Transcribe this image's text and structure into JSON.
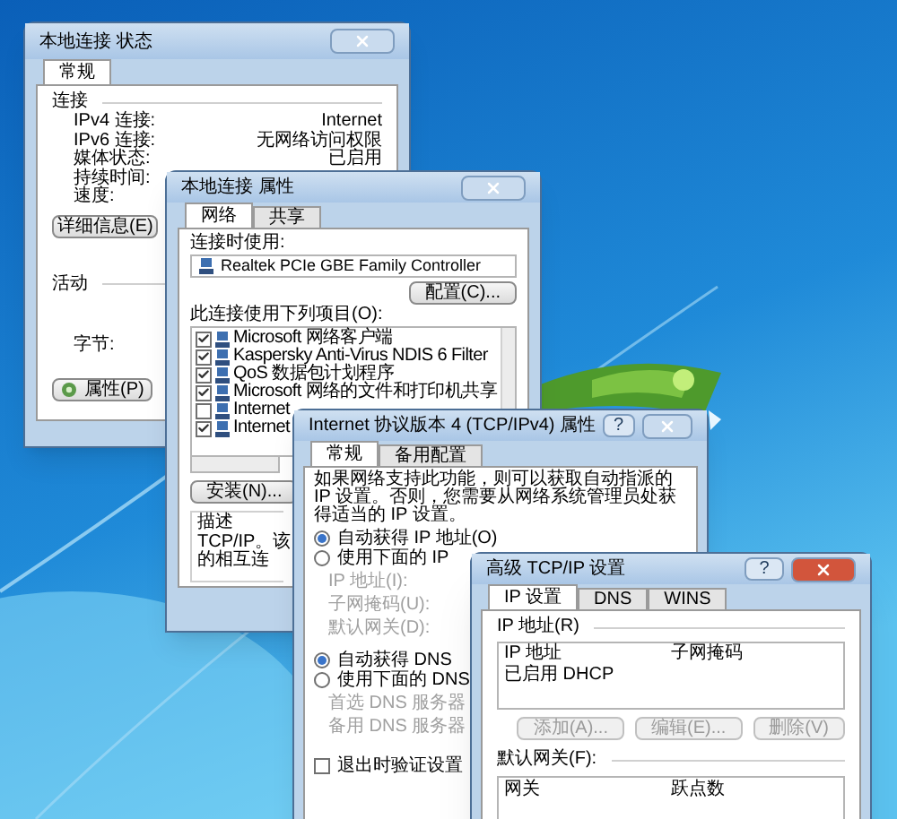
{
  "status_window": {
    "title": "本地连接 状态",
    "active": false,
    "tabs": [
      {
        "label": "常规",
        "selected": true
      }
    ],
    "connection_heading": "连接",
    "rows": [
      {
        "label": "IPv4 连接:",
        "value": "Internet"
      },
      {
        "label": "IPv6 连接:",
        "value": "无网络访问权限"
      },
      {
        "label": "媒体状态:",
        "value": "已启用"
      },
      {
        "label": "持续时间:"
      },
      {
        "label": "速度:"
      }
    ],
    "details_button": "详细信息(E)",
    "activity_heading": "活动",
    "bytes_label": "字节:",
    "properties_button": "属性(P)"
  },
  "properties_window": {
    "title": "本地连接 属性",
    "active": false,
    "tabs": [
      {
        "label": "网络",
        "selected": true
      },
      {
        "label": "共享",
        "selected": false
      }
    ],
    "connect_using_label": "连接时使用:",
    "adapter": "Realtek PCIe GBE Family Controller",
    "configure_button": "配置(C)...",
    "items_label": "此连接使用下列项目(O):",
    "items": [
      {
        "label": "Microsoft 网络客户端",
        "checked": true
      },
      {
        "label": "Kaspersky Anti-Virus NDIS 6 Filter",
        "checked": true
      },
      {
        "label": "QoS 数据包计划程序",
        "checked": true
      },
      {
        "label": "Microsoft 网络的文件和打印机共享",
        "checked": true
      },
      {
        "label": "Internet",
        "checked": false
      },
      {
        "label": "Internet",
        "checked": true
      }
    ],
    "install_button": "安装(N)...",
    "description_heading": "描述",
    "description_lines": [
      "TCP/IP。该",
      "的相互连"
    ]
  },
  "ipv4_window": {
    "title": "Internet 协议版本 4 (TCP/IPv4) 属性",
    "help": "?",
    "active": false,
    "tabs": [
      {
        "label": "常规",
        "selected": true
      },
      {
        "label": "备用配置",
        "selected": false
      }
    ],
    "intro": "如果网络支持此功能，则可以获取自动指派的 IP 设置。否则，您需要从网络系统管理员处获得适当的 IP 设置。",
    "ip_options": [
      {
        "label": "自动获得 IP 地址(O)",
        "selected": true
      },
      {
        "label": "使用下面的 IP",
        "selected": false
      }
    ],
    "ip_fields": [
      "IP 地址(I):",
      "子网掩码(U):",
      "默认网关(D):"
    ],
    "dns_options": [
      {
        "label": "自动获得 DNS",
        "selected": true
      },
      {
        "label": "使用下面的 DNS",
        "selected": false
      }
    ],
    "dns_fields": [
      "首选 DNS 服务器",
      "备用 DNS 服务器"
    ],
    "validate": {
      "label": "退出时验证设置",
      "checked": false
    }
  },
  "advanced_window": {
    "title": "高级 TCP/IP 设置",
    "help": "?",
    "active": true,
    "tabs": [
      {
        "label": "IP 设置",
        "selected": true
      },
      {
        "label": "DNS",
        "selected": false
      },
      {
        "label": "WINS",
        "selected": false
      }
    ],
    "ip_group": "IP 地址(R)",
    "ip_columns": [
      "IP 地址",
      "子网掩码"
    ],
    "ip_rows": [
      [
        "已启用 DHCP"
      ]
    ],
    "buttons": [
      {
        "label": "添加(A)...",
        "disabled": true
      },
      {
        "label": "编辑(E)...",
        "disabled": true
      },
      {
        "label": "删除(V)",
        "disabled": true
      }
    ],
    "gateway_label": "默认网关(F):",
    "gateway_columns": [
      "网关",
      "跃点数"
    ]
  }
}
